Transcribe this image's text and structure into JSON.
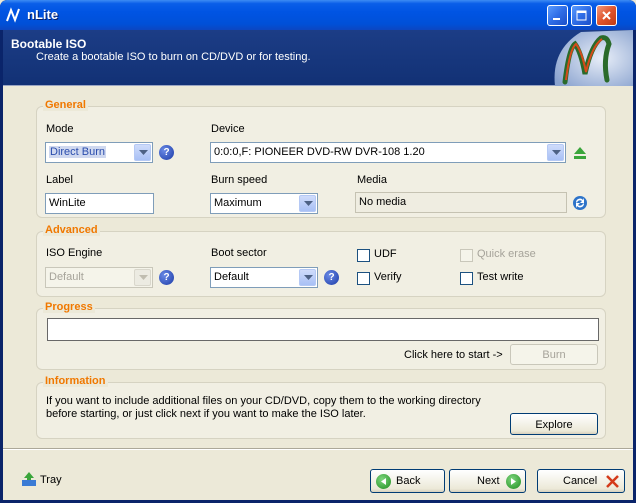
{
  "window": {
    "title": "nLite"
  },
  "header": {
    "title": "Bootable ISO",
    "subtitle": "Create a bootable ISO to burn on CD/DVD or for testing."
  },
  "general": {
    "title": "General",
    "mode_label": "Mode",
    "mode_value": "Direct Burn",
    "device_label": "Device",
    "device_value": "0:0:0,F: PIONEER  DVD-RW  DVR-108  1.20",
    "label_label": "Label",
    "label_value": "WinLite",
    "burn_speed_label": "Burn speed",
    "burn_speed_value": "Maximum",
    "media_label": "Media",
    "media_value": "No media"
  },
  "advanced": {
    "title": "Advanced",
    "iso_engine_label": "ISO Engine",
    "iso_engine_value": "Default",
    "boot_sector_label": "Boot sector",
    "boot_sector_value": "Default",
    "udf_label": "UDF",
    "verify_label": "Verify",
    "quick_erase_label": "Quick erase",
    "test_write_label": "Test write"
  },
  "progress": {
    "title": "Progress",
    "hint": "Click here to start ->",
    "burn_label": "Burn"
  },
  "information": {
    "title": "Information",
    "text_line1": "If you want to include additional files on your CD/DVD, copy them to the working directory",
    "text_line2": "before starting, or just click next if you want to make the ISO later.",
    "explore_label": "Explore"
  },
  "footer": {
    "tray_label": "Tray",
    "back_label": "Back",
    "next_label": "Next",
    "cancel_label": "Cancel"
  },
  "colors": {
    "accent": "#f07800",
    "header_bg": "#16377c",
    "titlebar": "#0054e3"
  }
}
